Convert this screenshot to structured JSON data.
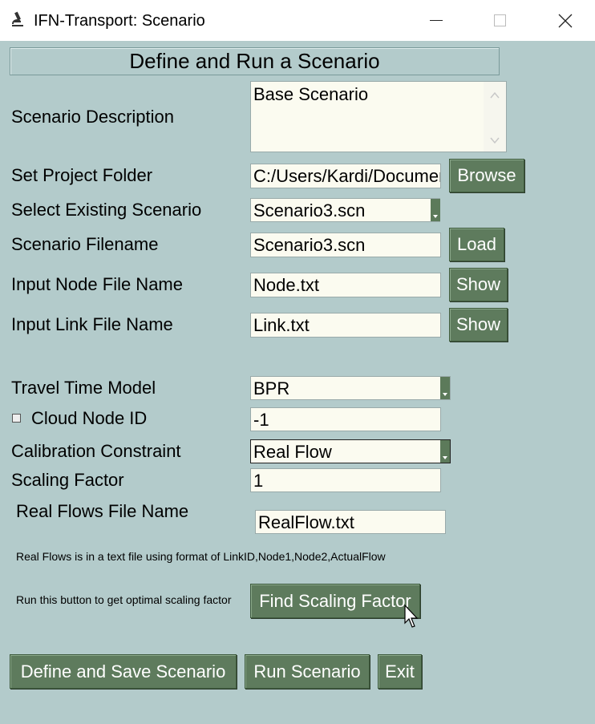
{
  "window": {
    "title": "IFN-Transport: Scenario"
  },
  "header": "Define and Run a Scenario",
  "labels": {
    "scenario_description": "Scenario Description",
    "project_folder": "Set Project Folder",
    "existing_scenario": "Select Existing Scenario",
    "scenario_filename": "Scenario Filename",
    "node_file": "Input Node File Name",
    "link_file": "Input Link File Name",
    "travel_time_model": "Travel Time Model",
    "cloud_node": "Cloud Node ID",
    "calibration": "Calibration Constraint",
    "scaling_factor": "Scaling Factor",
    "real_flows_file": "Real Flows File Name"
  },
  "fields": {
    "scenario_description": "Base Scenario",
    "project_folder": "C:/Users/Kardi/Documents",
    "existing_scenario": "Scenario3.scn",
    "scenario_filename": "Scenario3.scn",
    "node_file": "Node.txt",
    "link_file": "Link.txt",
    "travel_time_model": "BPR",
    "cloud_node": "-1",
    "calibration": "Real Flow",
    "scaling_factor": "1",
    "real_flows_file": "RealFlow.txt"
  },
  "cloud_node_checked": false,
  "notes": {
    "real_flows_format": "Real Flows is in a text file using format of LinkID,Node1,Node2,ActualFlow",
    "find_hint": "Run this button to get optimal scaling factor"
  },
  "buttons": {
    "browse": "Browse",
    "load": "Load",
    "show_node": "Show",
    "show_link": "Show",
    "find_scaling": "Find Scaling Factor",
    "define_save": "Define and Save Scenario",
    "run": "Run Scenario",
    "exit": "Exit"
  },
  "icons": {
    "app": "microscope-icon",
    "minimize": "minimize-icon",
    "maximize": "maximize-icon",
    "close": "close-icon",
    "cursor": "mouse-pointer-icon"
  }
}
